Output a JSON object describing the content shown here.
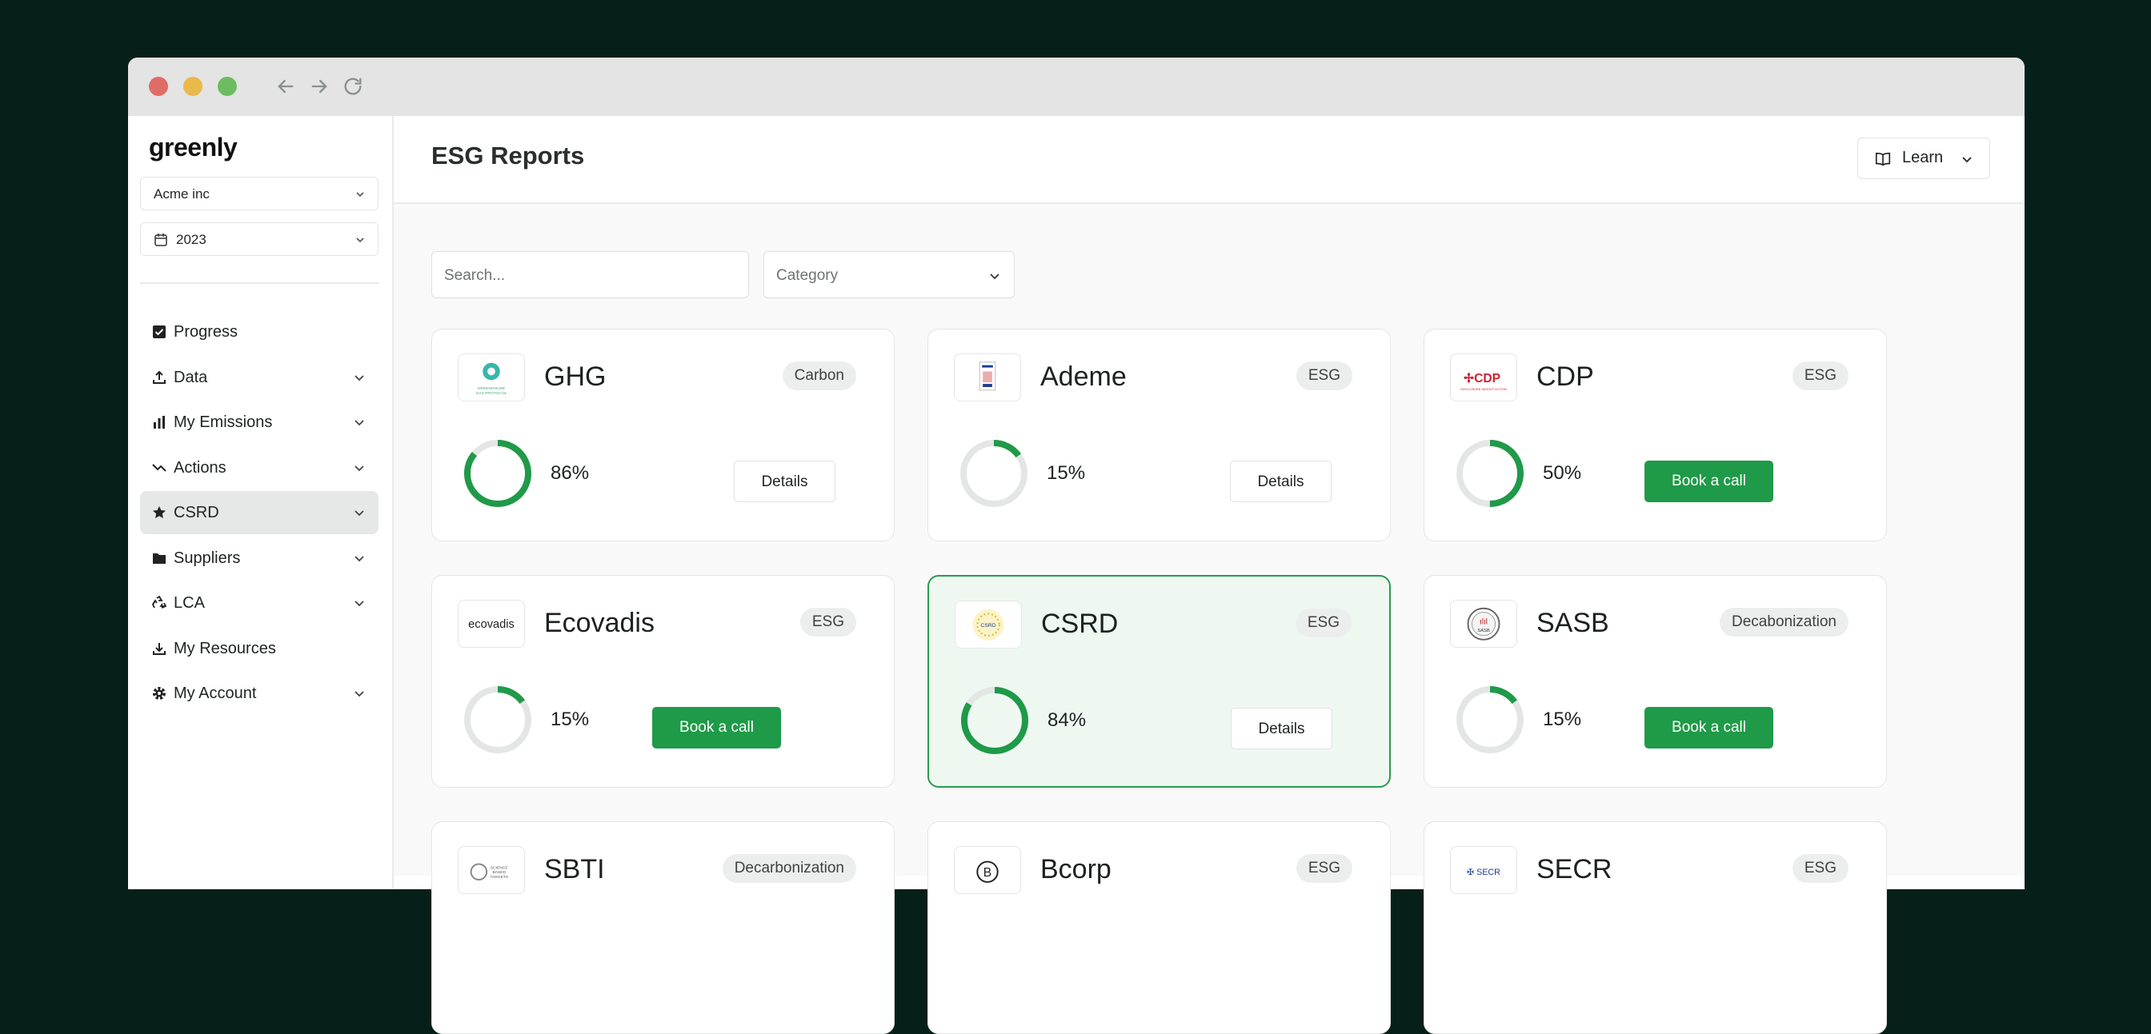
{
  "window": {
    "controls": [
      "close",
      "minimize",
      "maximize"
    ],
    "nav": [
      "back-icon",
      "forward-icon",
      "reload-icon"
    ]
  },
  "sidebar": {
    "logo": "greenly",
    "company_select": "Acme inc",
    "year_select": "2023",
    "items": [
      {
        "label": "Progress",
        "icon": "checkbox-icon",
        "has_chevron": false
      },
      {
        "label": "Data",
        "icon": "upload-icon",
        "has_chevron": true
      },
      {
        "label": "My Emissions",
        "icon": "bar-chart-icon",
        "has_chevron": true
      },
      {
        "label": "Actions",
        "icon": "trend-icon",
        "has_chevron": true
      },
      {
        "label": "CSRD",
        "icon": "star-icon",
        "has_chevron": true,
        "active": true
      },
      {
        "label": "Suppliers",
        "icon": "folder-icon",
        "has_chevron": true
      },
      {
        "label": "LCA",
        "icon": "recycle-icon",
        "has_chevron": true
      },
      {
        "label": "My Resources",
        "icon": "download-icon",
        "has_chevron": false
      },
      {
        "label": "My Account",
        "icon": "gear-icon",
        "has_chevron": true
      }
    ]
  },
  "header": {
    "title": "ESG Reports",
    "learn_label": "Learn"
  },
  "filters": {
    "search_placeholder": "Search...",
    "category_placeholder": "Category"
  },
  "colors": {
    "accent": "#1f9a48",
    "ring_track": "#e4e6e5",
    "highlight_bg": "#eef8f1",
    "highlight_border": "#2a9a4f"
  },
  "cards": [
    {
      "name": "GHG",
      "badge": "Carbon",
      "percent": 86,
      "percent_label": "86%",
      "action": "Details",
      "logo": "ghg-protocol-logo"
    },
    {
      "name": "Ademe",
      "badge": "ESG",
      "percent": 15,
      "percent_label": "15%",
      "action": "Details",
      "logo": "ademe-logo"
    },
    {
      "name": "CDP",
      "badge": "ESG",
      "percent": 50,
      "percent_label": "50%",
      "action": "Book a call",
      "logo": "cdp-logo"
    },
    {
      "name": "Ecovadis",
      "badge": "ESG",
      "percent": 15,
      "percent_label": "15%",
      "action": "Book a call",
      "logo": "ecovadis-logo",
      "logo_text": "ecovadis"
    },
    {
      "name": "CSRD",
      "badge": "ESG",
      "percent": 84,
      "percent_label": "84%",
      "action": "Details",
      "logo": "csrd-logo",
      "highlighted": true
    },
    {
      "name": "SASB",
      "badge": "Decabonization",
      "percent": 15,
      "percent_label": "15%",
      "action": "Book a call",
      "logo": "sasb-logo"
    },
    {
      "name": "SBTI",
      "badge": "Decarbonization",
      "logo": "sbti-logo"
    },
    {
      "name": "Bcorp",
      "badge": "ESG",
      "logo": "bcorp-logo"
    },
    {
      "name": "SECR",
      "badge": "ESG",
      "logo": "secr-logo"
    }
  ]
}
